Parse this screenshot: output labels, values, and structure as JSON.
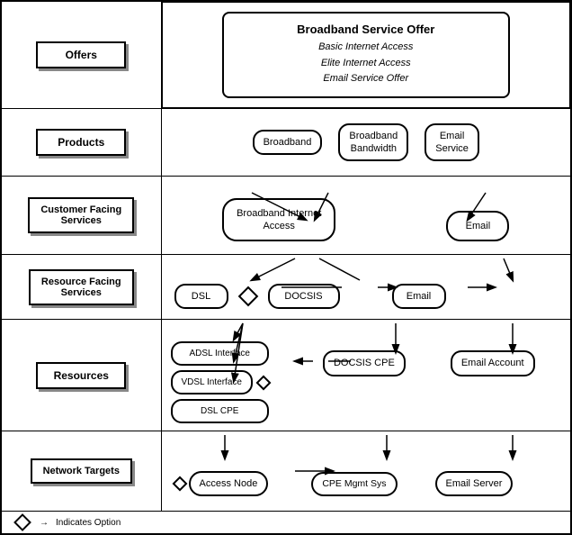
{
  "rows": {
    "offers": {
      "label": "Offers",
      "main_title": "Broadband Service Offer",
      "items": [
        "Basic Internet Access",
        "Elite Internet Access",
        "Email Service Offer"
      ]
    },
    "products": {
      "label": "Products",
      "items": [
        "Broadband",
        "Broadband Bandwidth",
        "Email Service"
      ]
    },
    "cfs": {
      "label": "Customer Facing Services",
      "items": [
        "Broadband Internet Access",
        "Email"
      ]
    },
    "rfs": {
      "label": "Resource Facing Services",
      "items": [
        "DSL",
        "DOCSIS",
        "Email"
      ]
    },
    "resources": {
      "label": "Resources",
      "left_items": [
        "ADSL Interface",
        "VDSL Interface",
        "DSL CPE"
      ],
      "mid_item": "DOCSIS CPE",
      "right_item": "Email Account"
    },
    "network_targets": {
      "label": "Network Targets",
      "items": [
        "Access Node",
        "CPE Mgmt Sys",
        "Email Server"
      ]
    }
  },
  "legend": {
    "diamond_label": "Indicates Option",
    "arrow_label": "→"
  }
}
